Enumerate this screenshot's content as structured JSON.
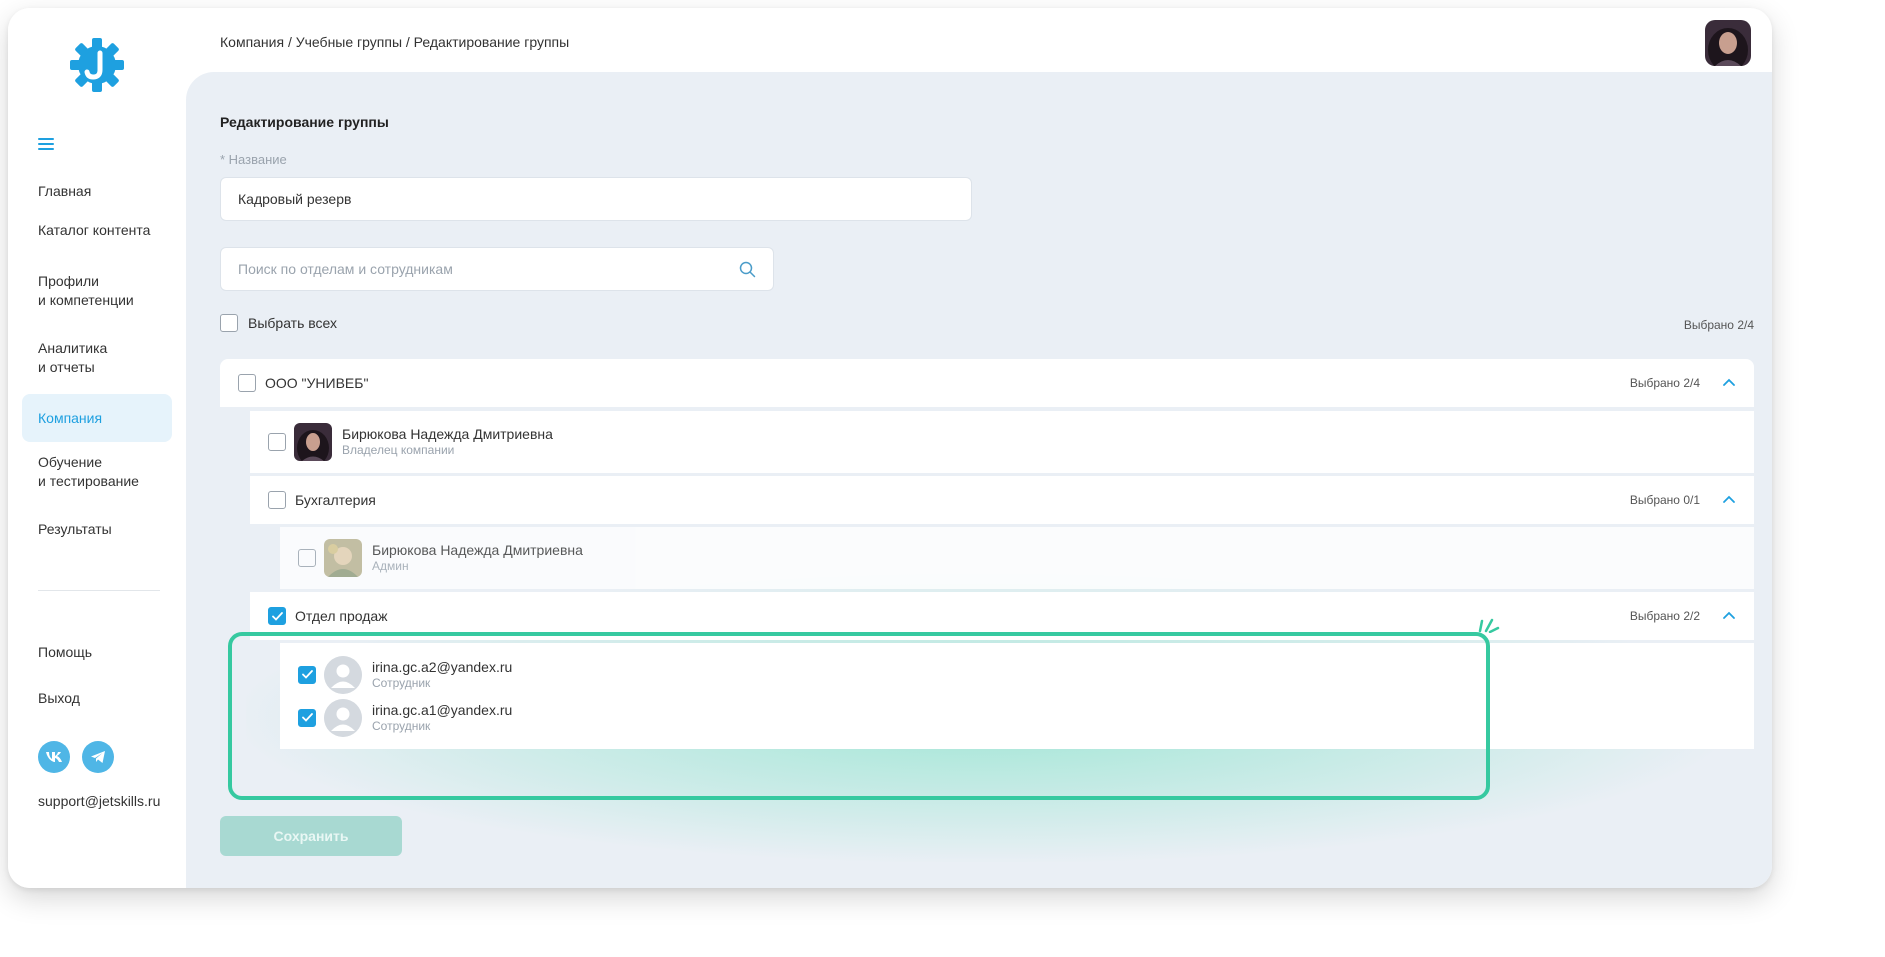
{
  "breadcrumb": "Компания / Учебные группы / Редактирование группы",
  "nav": {
    "items": [
      {
        "label": "Главная"
      },
      {
        "label": "Каталог контента"
      },
      {
        "label": "Профили\nи компетенции"
      },
      {
        "label": "Аналитика\nи отчеты"
      },
      {
        "label": "Компания",
        "active": true
      },
      {
        "label": "Обучение\nи тестирование"
      },
      {
        "label": "Результаты"
      }
    ],
    "bottom": [
      {
        "label": "Помощь"
      },
      {
        "label": "Выход"
      }
    ],
    "support_email": "support@jetskills.ru"
  },
  "form": {
    "title": "Редактирование группы",
    "name_label": "* Название",
    "name_value": "Кадровый резерв",
    "search_placeholder": "Поиск по отделам и сотрудникам",
    "select_all_label": "Выбрать всех",
    "select_all_count": "Выбрано 2/4",
    "save_label": "Сохранить"
  },
  "tree": {
    "company": {
      "name": "ООО \"УНИВЕБ\"",
      "count": "Выбрано 2/4",
      "checked": false
    },
    "owner": {
      "name": "Бирюкова Надежда Дмитриевна",
      "role": "Владелец компании",
      "checked": false
    },
    "dept_accounting": {
      "name": "Бухгалтерия",
      "count": "Выбрано 0/1",
      "checked": false
    },
    "accounting_member": {
      "name": "Бирюкова Надежда Дмитриевна",
      "role": "Админ",
      "checked": false
    },
    "dept_sales": {
      "name": "Отдел продаж",
      "count": "Выбрано 2/2",
      "checked": true
    },
    "sales_members": [
      {
        "name": "irina.gc.a2@yandex.ru",
        "role": "Сотрудник",
        "checked": true
      },
      {
        "name": "irina.gc.a1@yandex.ru",
        "role": "Сотрудник",
        "checked": true
      }
    ]
  },
  "colors": {
    "accent": "#1ea0e0",
    "highlight": "#36c9a0",
    "content_bg": "#eaeff5",
    "save_disabled": "#a8d9d2"
  }
}
